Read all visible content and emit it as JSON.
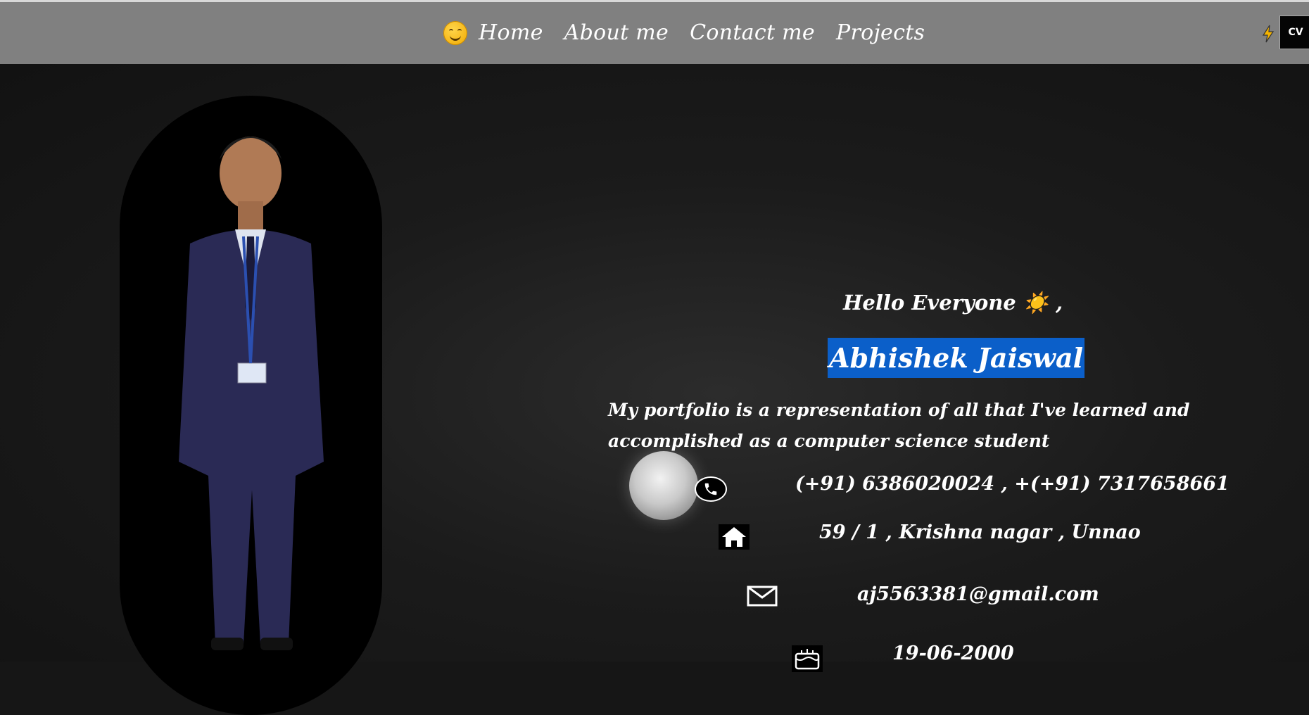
{
  "nav": {
    "links": [
      "Home",
      "About me",
      "Contact me",
      "Projects"
    ],
    "cv_label": "CV"
  },
  "hero": {
    "greeting": "Hello Everyone ☀️ ,",
    "name": "Abhishek Jaiswal",
    "tagline": "My portfolio is a representation of all that I've learned and accomplished as a computer science student",
    "phone": "(+91) 6386020024 , +(+91) 7317658661",
    "address": "59 / 1 , Krishna nagar , Unnao",
    "email": "aj5563381@gmail.com",
    "dob": "19-06-2000"
  },
  "colors": {
    "navbar": "#808080",
    "background": "#161616",
    "name_highlight": "#0b5fc9"
  },
  "icons": [
    "smiley-icon",
    "bolt-icon",
    "moon-icon",
    "phone-icon",
    "home-icon",
    "mail-icon",
    "cake-icon"
  ]
}
